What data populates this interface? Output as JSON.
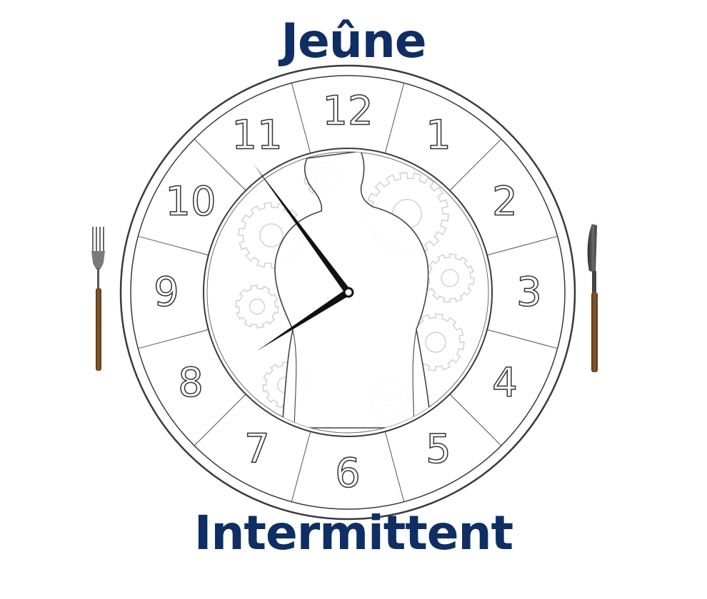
{
  "title_line1": "Jeûne",
  "title_line2": "Intermittent",
  "colors": {
    "title": "#0f2e63",
    "outline": "#3a3a3a",
    "hands": "#111111",
    "gears": "#cfcfcf",
    "wood": "#7a4e25",
    "metal": "#555555"
  },
  "clock": {
    "numerals": [
      "12",
      "1",
      "2",
      "3",
      "4",
      "5",
      "6",
      "7",
      "8",
      "9",
      "10",
      "11"
    ],
    "time_shown": "7:55"
  },
  "icons": {
    "left": "fork-icon",
    "right": "knife-icon",
    "center": "human-silhouette-icon",
    "background": "gears-icon"
  }
}
